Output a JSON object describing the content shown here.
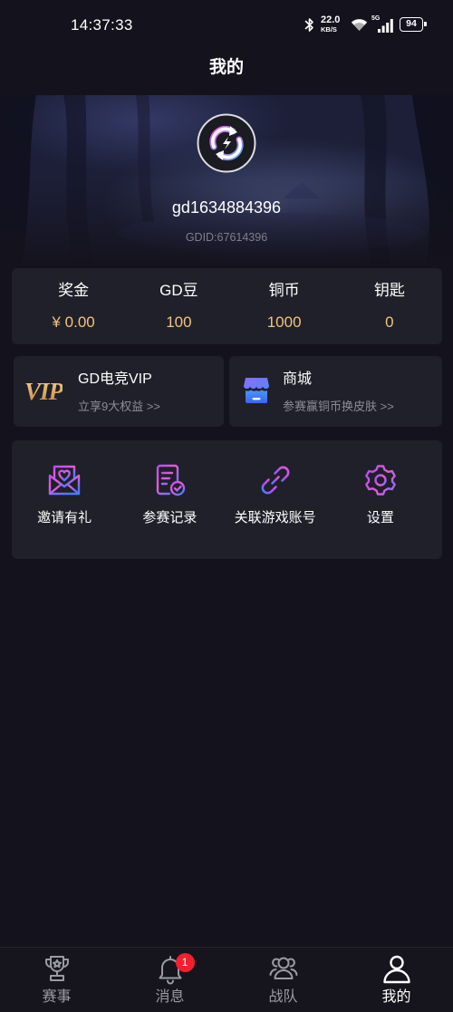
{
  "status_bar": {
    "time": "14:37:33",
    "net_speed_value": "22.0",
    "net_speed_unit": "KB/S",
    "network_type": "5G",
    "battery": "94"
  },
  "header": {
    "title": "我的"
  },
  "profile": {
    "username": "gd1634884396",
    "gdid": "GDID:67614396"
  },
  "stats": [
    {
      "label": "奖金",
      "value": "¥ 0.00"
    },
    {
      "label": "GD豆",
      "value": "100"
    },
    {
      "label": "铜币",
      "value": "1000"
    },
    {
      "label": "钥匙",
      "value": "0"
    }
  ],
  "promo_cards": {
    "vip": {
      "logo_text": "VIP",
      "title": "GD电竞VIP",
      "subtitle": "立享9大权益 >>"
    },
    "shop": {
      "icon": "store-icon",
      "title": "商城",
      "subtitle": "参赛赢铜币换皮肤 >>"
    }
  },
  "menu": [
    {
      "label": "邀请有礼",
      "icon": "envelope-heart-icon"
    },
    {
      "label": "参赛记录",
      "icon": "document-check-icon"
    },
    {
      "label": "关联游戏账号",
      "icon": "link-icon"
    },
    {
      "label": "设置",
      "icon": "gear-icon"
    }
  ],
  "bottom_nav": [
    {
      "label": "赛事",
      "icon": "trophy-icon",
      "active": false
    },
    {
      "label": "消息",
      "icon": "bell-icon",
      "badge": "1",
      "active": false
    },
    {
      "label": "战队",
      "icon": "team-icon",
      "active": false
    },
    {
      "label": "我的",
      "icon": "person-icon",
      "active": true
    }
  ],
  "colors": {
    "background": "#14121c",
    "card": "#1f2029",
    "value_gold": "#f3c37e",
    "text_muted": "#8c8c97",
    "nav_inactive": "#9a9aa5",
    "badge": "#f2202f",
    "icon_gradient_start": "#b84cf6",
    "icon_gradient_mid": "#e65ad6",
    "icon_gradient_end": "#4a7bff"
  }
}
